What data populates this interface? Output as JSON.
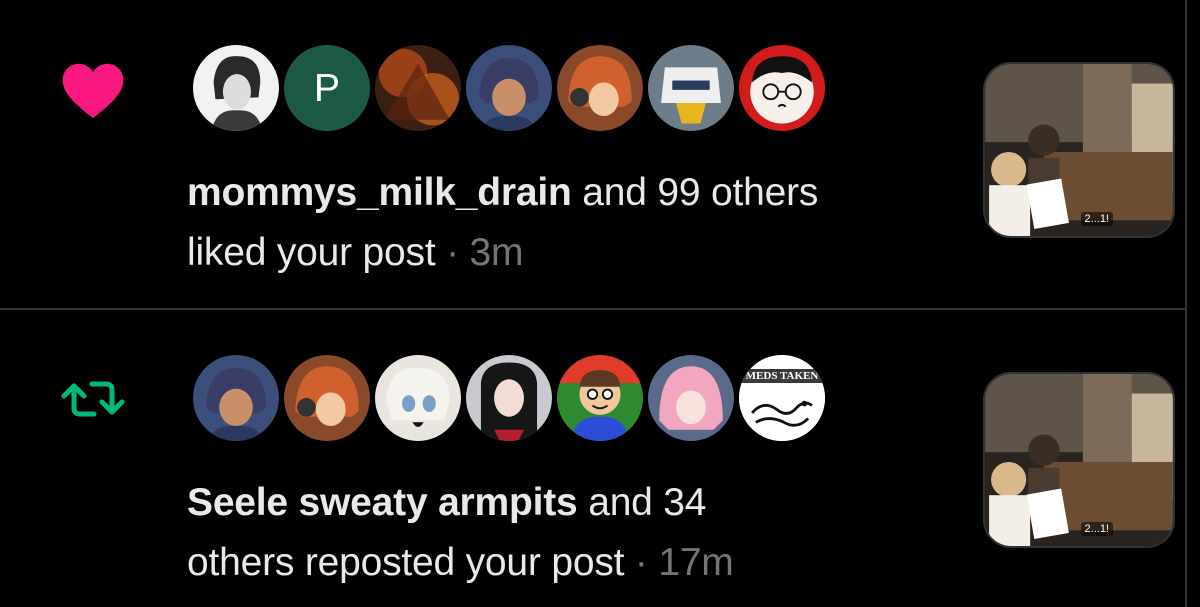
{
  "colors": {
    "like": "#f91880",
    "repost": "#00ba7c",
    "secondary": "#71767b",
    "text": "#e7e9ea",
    "divider": "#2f3336"
  },
  "notifications": [
    {
      "type": "like",
      "icon": "heart-icon",
      "actor": "mommys_milk_drain",
      "rest": " and 99 others",
      "line2": "liked your post",
      "dot": " · ",
      "time": "3m",
      "avatar_letter": "P",
      "thumb_badge": "2...1!"
    },
    {
      "type": "repost",
      "icon": "repost-icon",
      "actor": "Seele sweaty armpits",
      "rest": " and 34",
      "line2": "others reposted your post",
      "dot": " · ",
      "time": "17m",
      "meds_label": "MEDS TAKEN",
      "thumb_badge": "2...1!"
    }
  ]
}
